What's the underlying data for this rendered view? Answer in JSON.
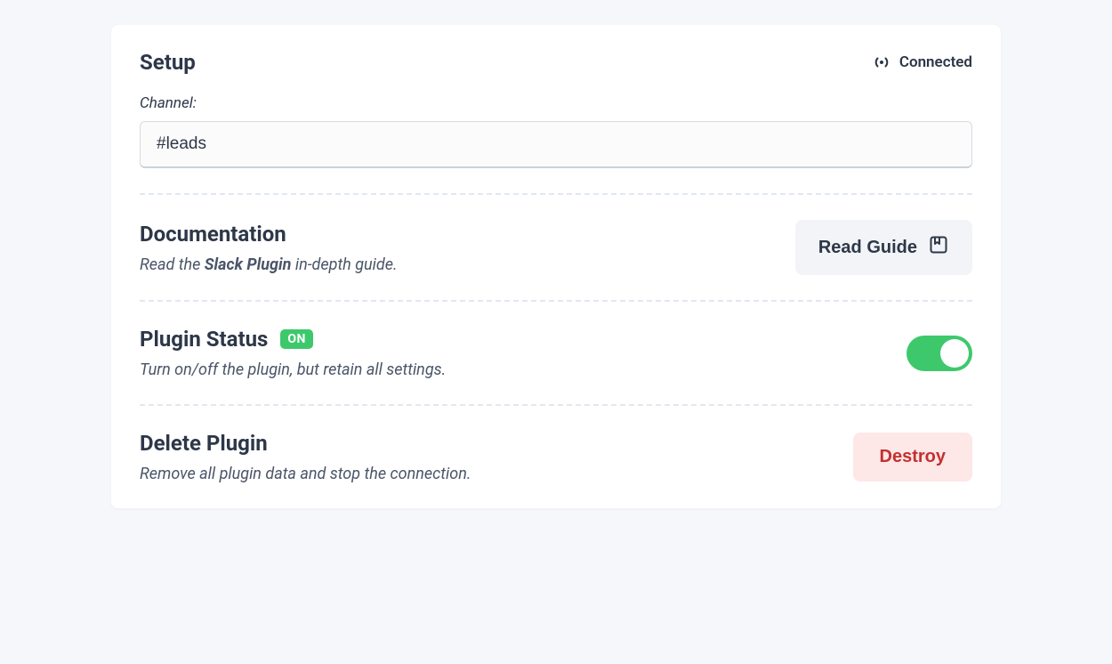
{
  "setup": {
    "title": "Setup",
    "connected_label": "Connected",
    "channel_label": "Channel:",
    "channel_value": "#leads"
  },
  "documentation": {
    "title": "Documentation",
    "desc_prefix": "Read the ",
    "desc_bold": "Slack Plugin",
    "desc_suffix": " in-depth guide.",
    "button_label": "Read Guide"
  },
  "plugin_status": {
    "title": "Plugin Status",
    "badge": "ON",
    "desc": "Turn on/off the plugin, but retain all settings."
  },
  "delete_plugin": {
    "title": "Delete Plugin",
    "desc": "Remove all plugin data and stop the connection.",
    "button_label": "Destroy"
  }
}
